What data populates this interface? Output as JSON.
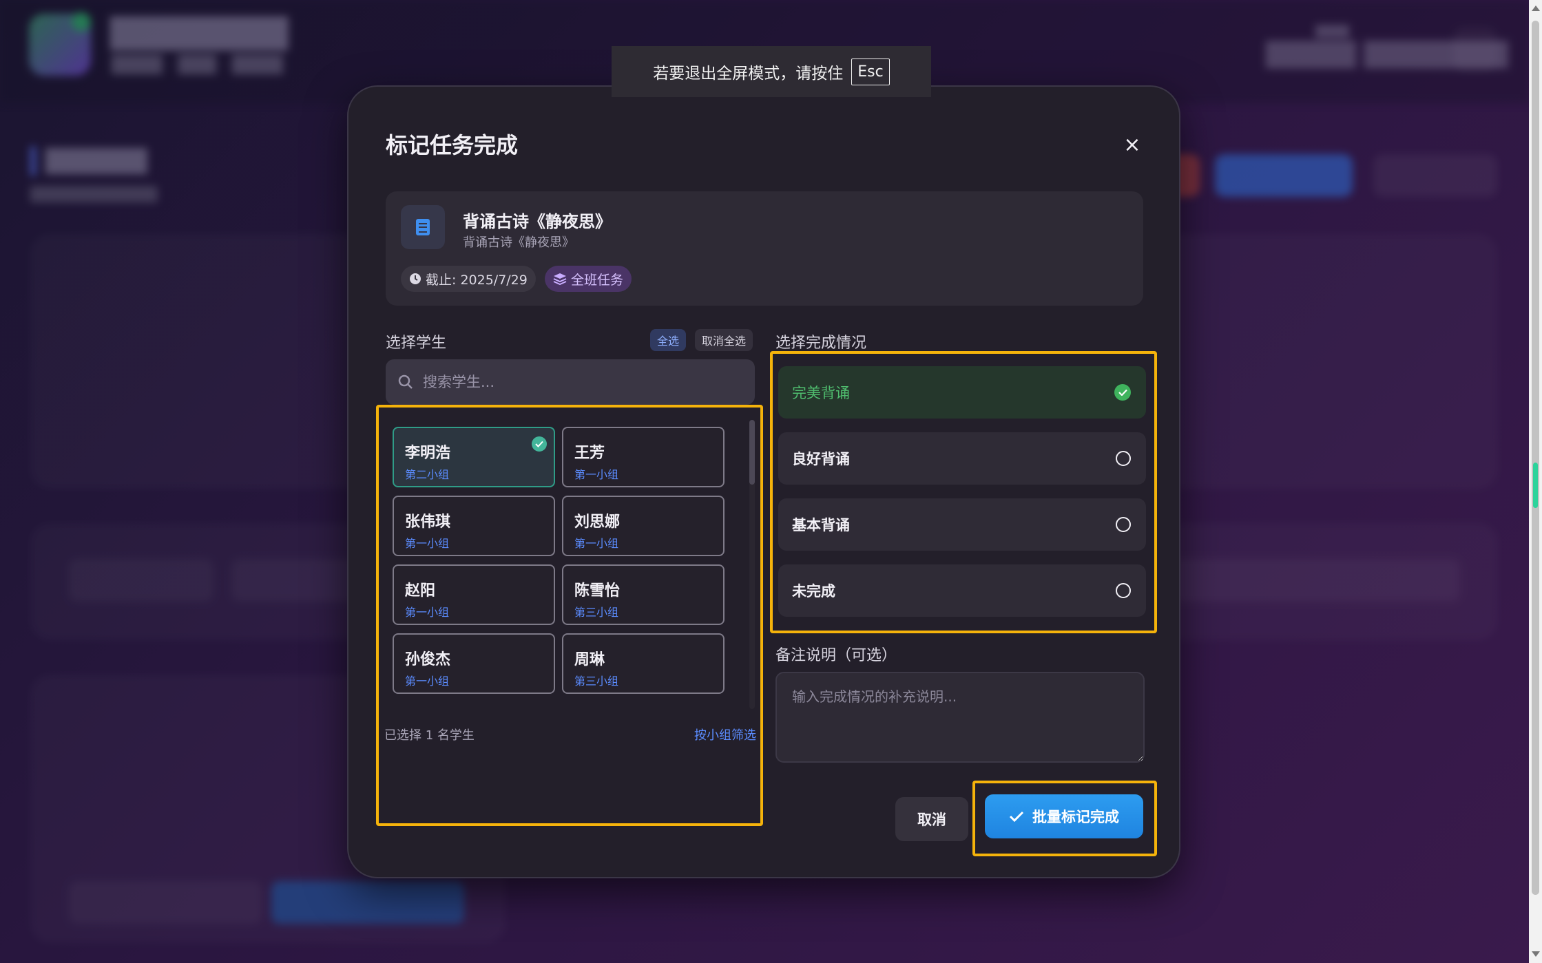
{
  "toast": {
    "prefix": "若要退出全屏模式，请按住",
    "key": "Esc"
  },
  "modal": {
    "title": "标记任务完成",
    "close_label": "×",
    "task": {
      "name": "背诵古诗《静夜思》",
      "description": "背诵古诗《静夜思》",
      "deadline": "截止: 2025/7/29",
      "scope": "全班任务"
    },
    "students": {
      "section_label": "选择学生",
      "select_all": "全选",
      "deselect_all": "取消全选",
      "search_placeholder": "搜索学生...",
      "items": [
        {
          "name": "李明浩",
          "group": "第二小组",
          "selected": true
        },
        {
          "name": "王芳",
          "group": "第一小组",
          "selected": false
        },
        {
          "name": "张伟琪",
          "group": "第一小组",
          "selected": false
        },
        {
          "name": "刘思娜",
          "group": "第一小组",
          "selected": false
        },
        {
          "name": "赵阳",
          "group": "第一小组",
          "selected": false
        },
        {
          "name": "陈雪怡",
          "group": "第三小组",
          "selected": false
        },
        {
          "name": "孙俊杰",
          "group": "第一小组",
          "selected": false
        },
        {
          "name": "周琳",
          "group": "第三小组",
          "selected": false
        }
      ],
      "selected_count": "已选择 1 名学生",
      "group_filter": "按小组筛选"
    },
    "status": {
      "section_label": "选择完成情况",
      "options": [
        {
          "label": "完美背诵",
          "active": true
        },
        {
          "label": "良好背诵",
          "active": false
        },
        {
          "label": "基本背诵",
          "active": false
        },
        {
          "label": "未完成",
          "active": false
        }
      ]
    },
    "note": {
      "label": "备注说明（可选）",
      "placeholder": "输入完成情况的补充说明..."
    },
    "cancel_label": "取消",
    "submit_label": "批量标记完成"
  },
  "colors": {
    "accent_highlight": "#f5b30b",
    "primary": "#1f84e0",
    "success": "#3fb35d",
    "selected_border": "#2f9c87"
  }
}
